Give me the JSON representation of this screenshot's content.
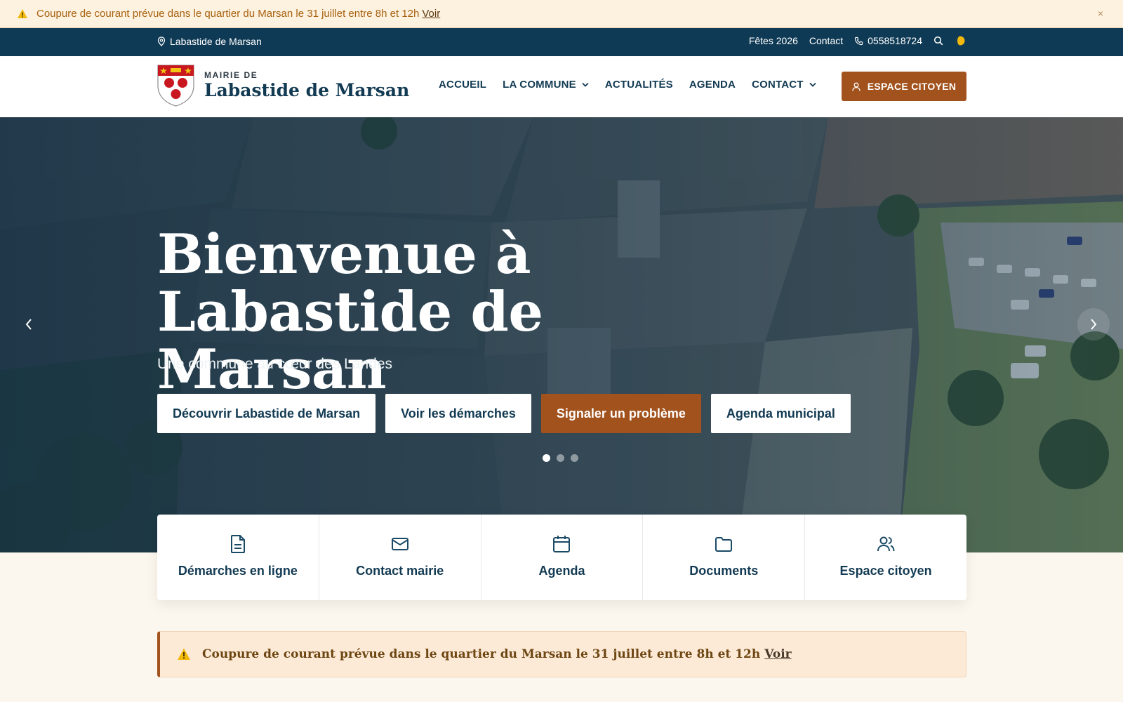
{
  "alert_top": {
    "text": "Coupure de courant prévue dans le quartier du Marsan le 31 juillet entre 8h et 12h",
    "link": "Voir",
    "close": "×"
  },
  "utility": {
    "location": "Labastide de Marsan",
    "fetes": "Fêtes 2026",
    "contact": "Contact",
    "phone": "0558518724"
  },
  "header": {
    "brand_small": "MAIRIE DE",
    "brand_name": "Labastide de Marsan",
    "cta": "ESPACE CITOYEN"
  },
  "nav": [
    {
      "label": "ACCUEIL"
    },
    {
      "label": "LA COMMUNE"
    },
    {
      "label": "ACTUALITÉS"
    },
    {
      "label": "AGENDA"
    },
    {
      "label": "CONTACT"
    }
  ],
  "hero": {
    "title": "Bienvenue à Labastide de Marsan",
    "subtitle": "Une commune au cœur des Landes",
    "buttons": [
      "Découvrir Labastide de Marsan",
      "Voir les démarches",
      "Signaler un problème",
      "Agenda municipal"
    ],
    "slides": 3,
    "active_slide": 1
  },
  "quick": [
    "Démarches en ligne",
    "Contact mairie",
    "Agenda",
    "Documents",
    "Espace citoyen"
  ],
  "alert_bottom": {
    "text": "Coupure de courant prévue dans le quartier du Marsan le 31 juillet entre 8h et 12h",
    "link": "Voir"
  },
  "colors": {
    "navy": "#0f3a55",
    "accent": "#a2521c",
    "cream": "#fcf7ee"
  }
}
